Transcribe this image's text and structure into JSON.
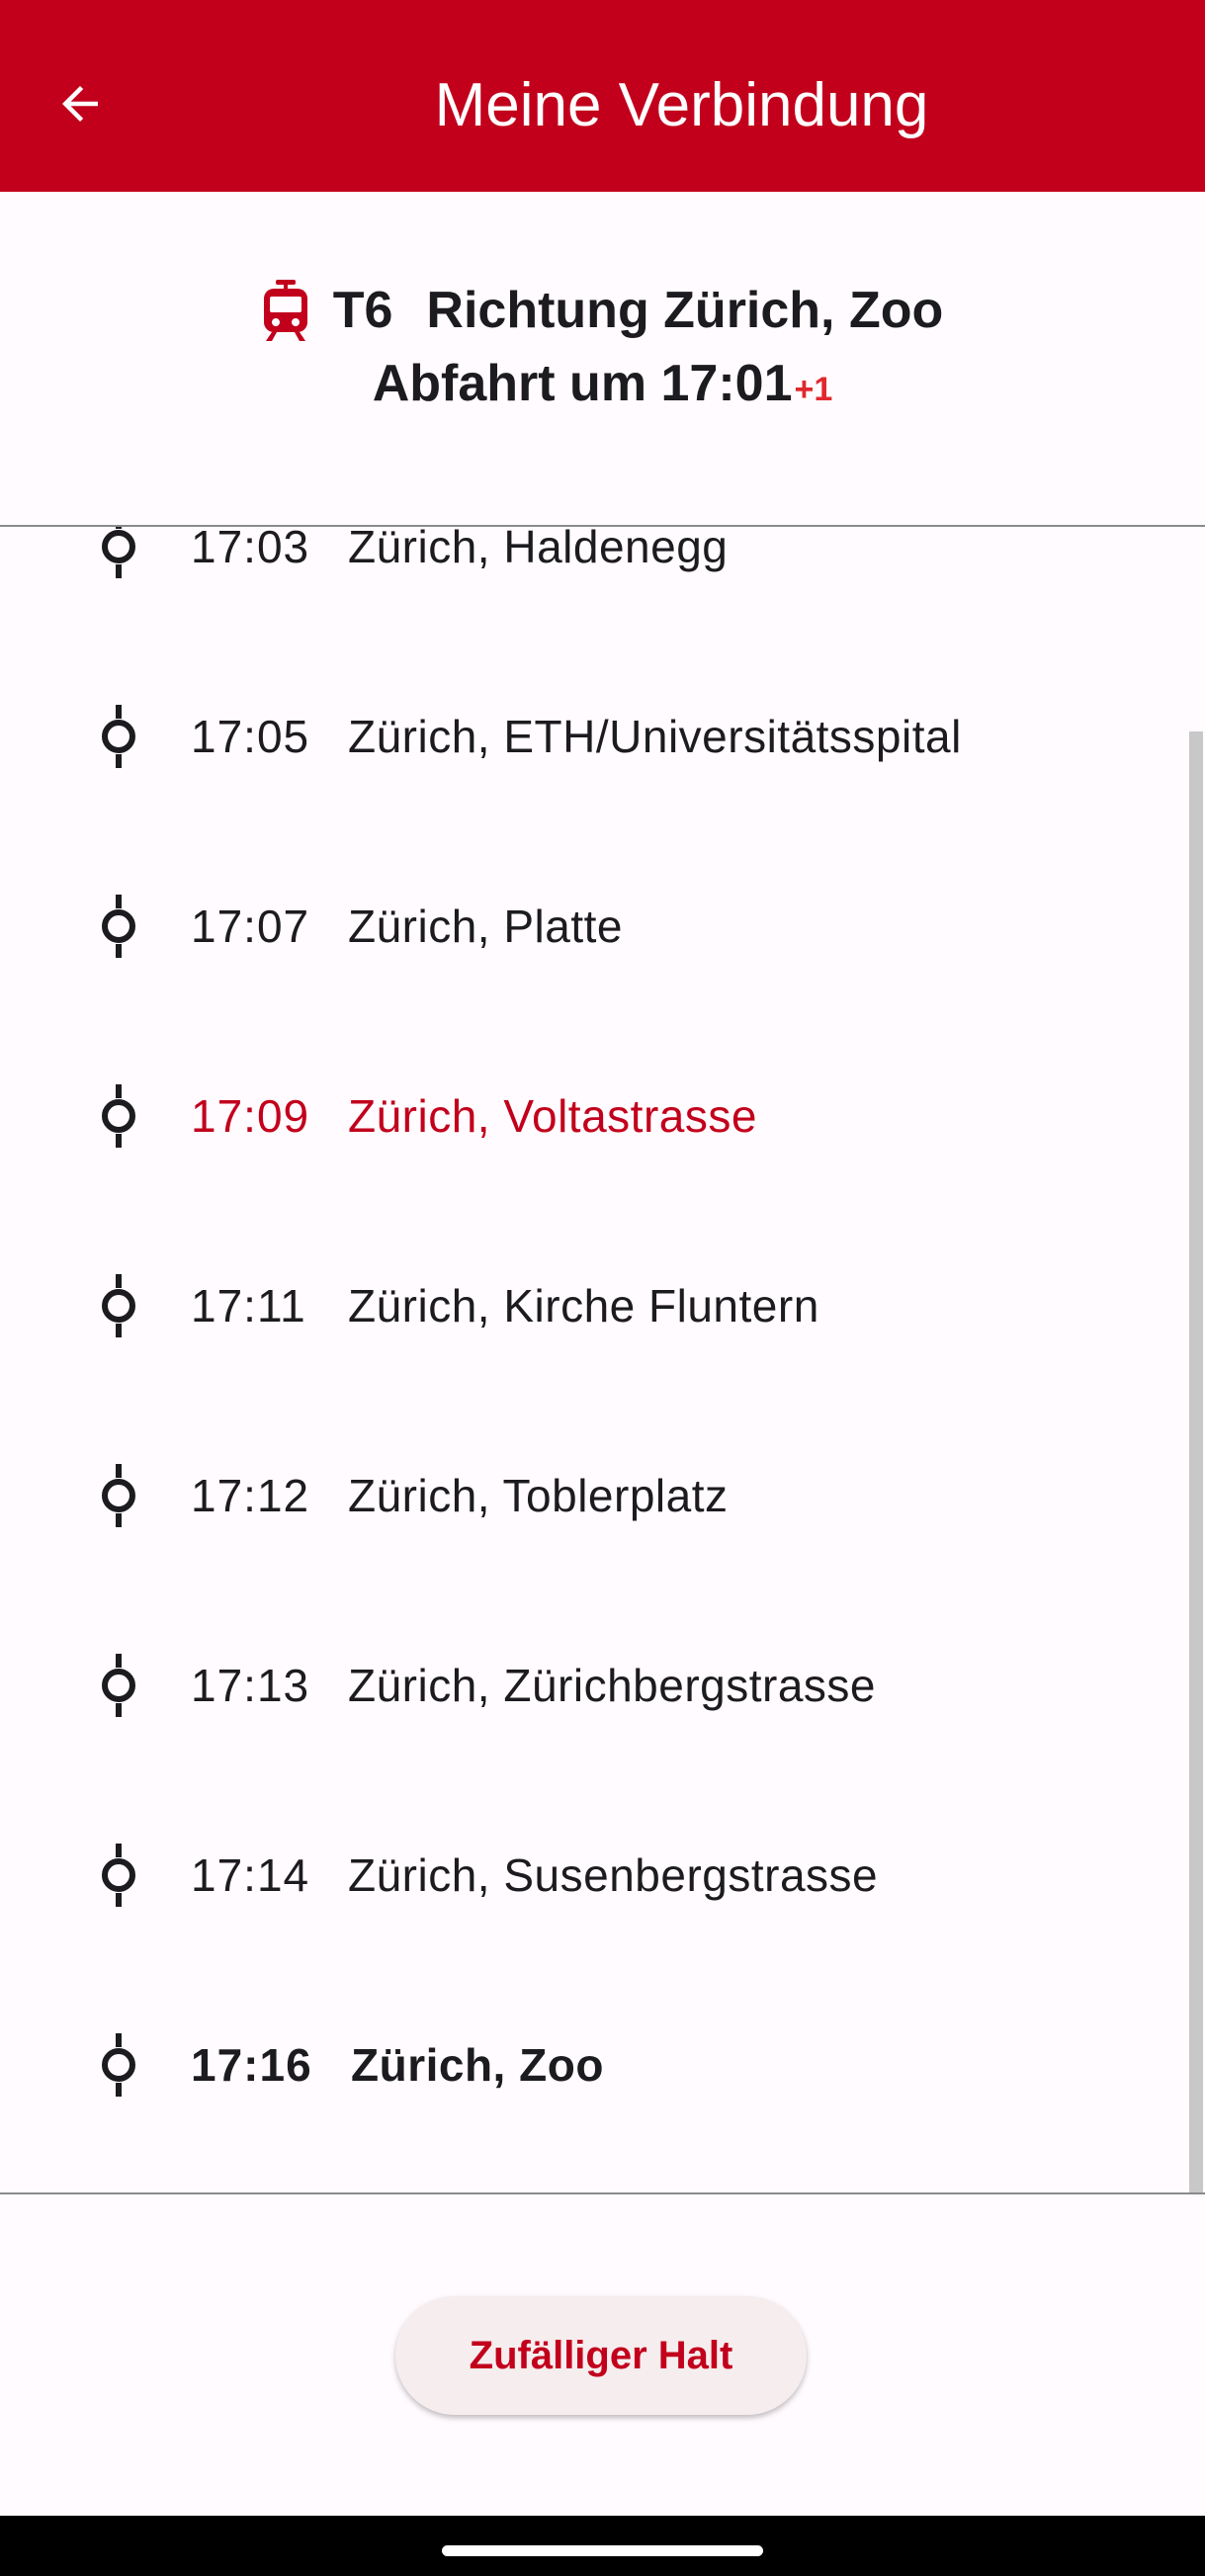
{
  "appbar": {
    "title": "Meine Verbindung",
    "back_icon": "arrow-back-icon"
  },
  "connection": {
    "line": "T6",
    "direction": "Richtung Zürich, Zoo",
    "departure": "Abfahrt um 17:01",
    "delay": "+1",
    "vehicle_icon": "tram-icon"
  },
  "stops": [
    {
      "time": "17:03",
      "name": "Zürich, Haldenegg"
    },
    {
      "time": "17:05",
      "name": "Zürich, ETH/Universitätsspital"
    },
    {
      "time": "17:07",
      "name": "Zürich, Platte"
    },
    {
      "time": "17:09",
      "name": "Zürich, Voltastrasse"
    },
    {
      "time": "17:11",
      "name": "Zürich, Kirche Fluntern"
    },
    {
      "time": "17:12",
      "name": "Zürich, Toblerplatz"
    },
    {
      "time": "17:13",
      "name": "Zürich, Zürichbergstrasse"
    },
    {
      "time": "17:14",
      "name": "Zürich, Susenbergstrasse"
    },
    {
      "time": "17:16",
      "name": "Zürich, Zoo"
    }
  ],
  "random_stop_button": "Zufälliger Halt",
  "colors": {
    "brand": "#c2001c",
    "delay": "#e0282e",
    "background": "#fffbfe"
  }
}
